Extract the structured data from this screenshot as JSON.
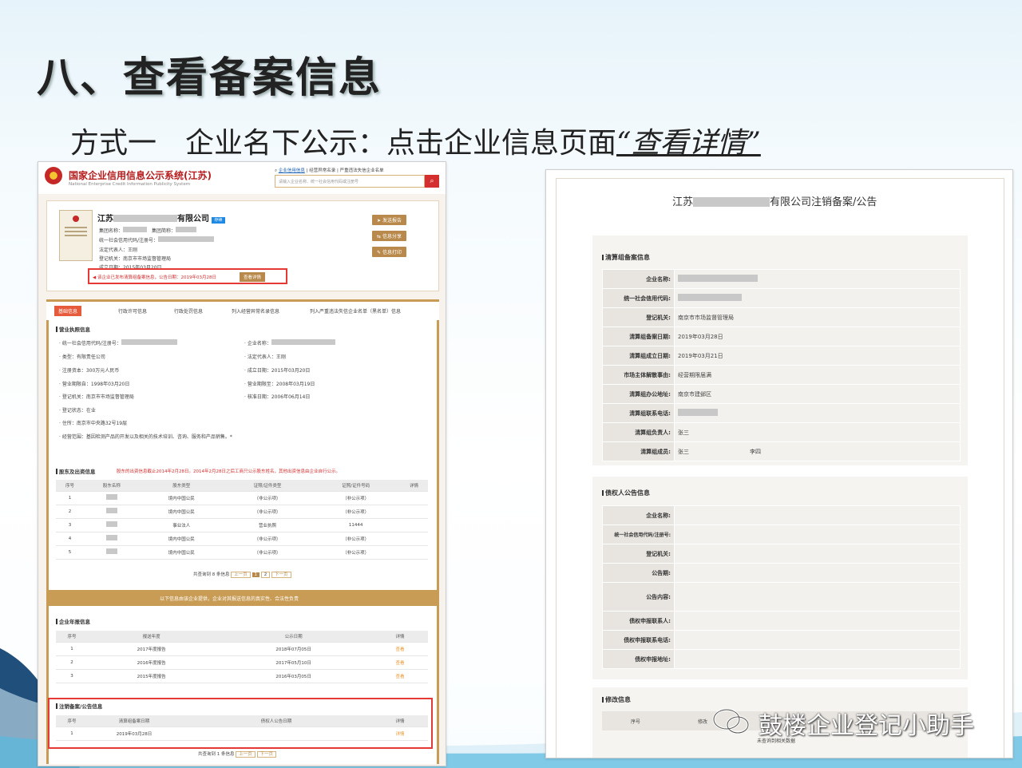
{
  "slide": {
    "title": "八、查看备案信息",
    "subtitle_prefix": "方式一　企业名下公示：点击企业信息页面",
    "subtitle_highlight": "“查看详情”"
  },
  "left": {
    "logo_title": "国家企业信用信息公示系统(江苏)",
    "logo_en": "National Enterprise Credit Information Publicity System",
    "top_links": [
      "企业信用信息",
      "经营异常名录",
      "严重违法失信企业名单"
    ],
    "search_placeholder": "请输入企业名称、统一社会信用代码或注册号",
    "company_prefix": "江苏",
    "company_suffix": "有限公司",
    "status_badge": "存续",
    "info_lines": {
      "group_a": "集团名称：",
      "group_b": "集团简称：",
      "credit_code": "统一社会信用代码/注册号：",
      "legal": "法定代表人：王刚",
      "reg_org": "登记机关：南京市市场监督管理局",
      "est_date": "成立日期：2015年03月20日"
    },
    "action_buttons": [
      "发送报告",
      "信息分享",
      "信息打印"
    ],
    "notice": "该企业已发布清算组备案信息，公告日期：2019年03月28日",
    "notice_btn": "查看详情",
    "tabs": [
      "基础信息",
      "行政许可信息",
      "行政处罚信息",
      "列入经营异常名录信息",
      "列入严重违法失信企业名单（黑名单）信息"
    ],
    "biz_section": "营业执照信息",
    "biz_fields": {
      "code": "· 统一社会信用代码/注册号：",
      "name": "· 企业名称：",
      "type": "· 类型：有限责任公司",
      "legal": "· 法定代表人：王刚",
      "capital": "· 注册资本：300万元人民币",
      "est": "· 成立日期：2015年03月20日",
      "from": "· 营业期限自：1998年03月20日",
      "to": "· 营业期限至：2008年03月19日",
      "org": "· 登记机关：南京市市场监督管理局",
      "approve": "· 核准日期：2006年06月14日",
      "status": "· 登记状态：在业",
      "address": "· 住所：南京市中央路32号19层",
      "scope": "· 经营范围：基因检测产品的开发以及相关的技术培训、咨询、服务和产品销售。*"
    },
    "shareholder_section": "股东及出资信息",
    "shareholder_notice": "股东的出资信息截止2014年2月28日。2014年2月28日之后工商只公示股东姓名，其他出资信息由企业自行公示。",
    "sh_headers": [
      "序号",
      "股东名称",
      "股东类型",
      "证照/证件类型",
      "证照/证件号码",
      "详情"
    ],
    "sh_rows": [
      [
        "1",
        "",
        "境内中国公民",
        "（非公示项）",
        "（非公示项）",
        ""
      ],
      [
        "2",
        "",
        "境内中国公民",
        "（非公示项）",
        "（非公示项）",
        ""
      ],
      [
        "3",
        "",
        "事业法人",
        "营业执照",
        "11444",
        ""
      ],
      [
        "4",
        "",
        "境内中国公民",
        "（非公示项）",
        "（非公示项）",
        ""
      ],
      [
        "5",
        "",
        "境内中国公民",
        "（非公示项）",
        "（非公示项）",
        ""
      ]
    ],
    "sh_pager": {
      "total": "共查询到 8 条信息",
      "prev": "上一页",
      "p1": "1",
      "p2": "2",
      "next": "下一页"
    },
    "disclaimer": "以下信息由该企业提供，企业对其报送信息的真实性、合法性负责",
    "annual_section": "企业年报信息",
    "annual_headers": [
      "序号",
      "报送年度",
      "公示日期",
      "详情"
    ],
    "annual_rows": [
      [
        "1",
        "2017年度报告",
        "2018年07月05日",
        "查看"
      ],
      [
        "2",
        "2016年度报告",
        "2017年05月10日",
        "查看"
      ],
      [
        "3",
        "2015年度报告",
        "2016年03月05日",
        "查看"
      ]
    ],
    "cancel_section": "注销备案/公告信息",
    "cancel_headers": [
      "序号",
      "清算组备案日期",
      "债权人公告日期",
      "详情"
    ],
    "cancel_rows": [
      [
        "1",
        "2019年03月28日",
        "",
        "详情"
      ]
    ],
    "cancel_pager": {
      "total": "共查询到 1 条信息",
      "prev": "上一页",
      "next": "下一页"
    }
  },
  "right": {
    "title_prefix": "江苏",
    "title_suffix": "有限公司注销备案/公告",
    "sec1": "清算组备案信息",
    "fields1": [
      [
        "企业名称:",
        ""
      ],
      [
        "统一社会信用代码:",
        ""
      ],
      [
        "登记机关:",
        "南京市市场监督管理局"
      ],
      [
        "清算组备案日期:",
        "2019年03月28日"
      ],
      [
        "清算组成立日期:",
        "2019年03月21日"
      ],
      [
        "市场主体解散事由:",
        "经营期限届满"
      ],
      [
        "清算组办公地址:",
        "南京市建邺区"
      ],
      [
        "清算组联系电话:",
        ""
      ],
      [
        "清算组负责人:",
        "张三"
      ],
      [
        "清算组成员:",
        "张三"
      ]
    ],
    "member2": "李四",
    "sec2": "债权人公告信息",
    "fields2": [
      "企业名称:",
      "统一社会信用代码/注册号:",
      "登记机关:",
      "公告期:",
      "公告内容:",
      "债权申报联系人:",
      "债权申报联系电话:",
      "债权申报地址:"
    ],
    "sec3": "修改信息",
    "mod_headers": [
      "序号",
      "修改"
    ],
    "mod_empty": "未查询到相关数据",
    "watermark": "鼓楼企业登记小助手"
  }
}
